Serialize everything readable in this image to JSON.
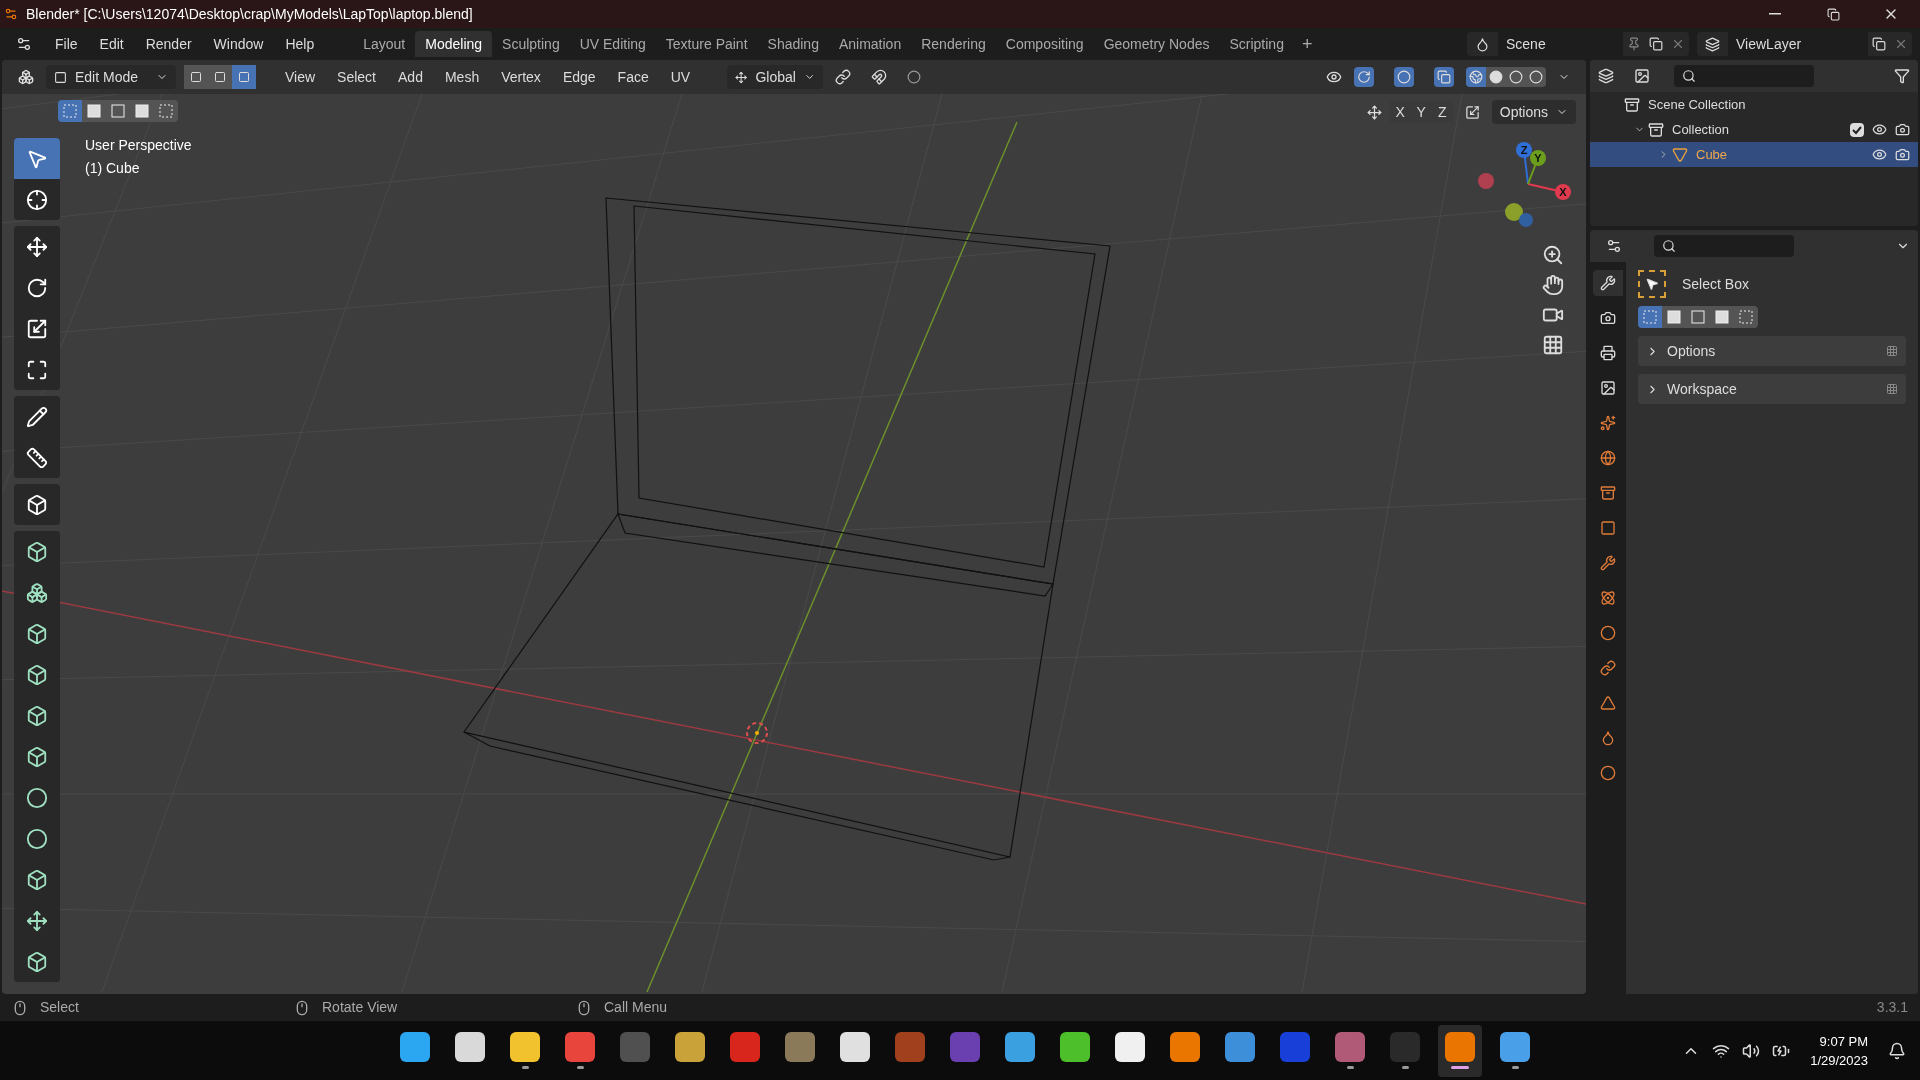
{
  "window": {
    "title": "Blender* [C:\\Users\\12074\\Desktop\\crap\\MyModels\\LapTop\\laptop.blend]"
  },
  "menus": [
    "File",
    "Edit",
    "Render",
    "Window",
    "Help"
  ],
  "workspaces": [
    {
      "label": "Layout",
      "selected": false
    },
    {
      "label": "Modeling",
      "selected": true
    },
    {
      "label": "Sculpting",
      "selected": false
    },
    {
      "label": "UV Editing",
      "selected": false
    },
    {
      "label": "Texture Paint",
      "selected": false
    },
    {
      "label": "Shading",
      "selected": false
    },
    {
      "label": "Animation",
      "selected": false
    },
    {
      "label": "Rendering",
      "selected": false
    },
    {
      "label": "Compositing",
      "selected": false
    },
    {
      "label": "Geometry Nodes",
      "selected": false
    },
    {
      "label": "Scripting",
      "selected": false
    }
  ],
  "add_workspace": "+",
  "scene": "Scene",
  "view_layer": "ViewLayer",
  "viewport_header": {
    "mode": "Edit Mode",
    "select_modes": [
      {
        "selected": false
      },
      {
        "selected": false
      },
      {
        "selected": true
      }
    ],
    "menus": [
      "View",
      "Select",
      "Add",
      "Mesh",
      "Vertex",
      "Edge",
      "Face",
      "UV"
    ],
    "orientation": "Global",
    "axes": [
      "X",
      "Y",
      "Z"
    ],
    "options": "Options",
    "box_modes": [
      {
        "selected": true
      },
      {
        "selected": false
      },
      {
        "selected": false
      },
      {
        "selected": false
      },
      {
        "selected": false
      }
    ]
  },
  "viewport": {
    "view_name": "User Perspective",
    "object_info": "(1) Cube",
    "gizmo": [
      {
        "label": "Z",
        "color": "#2f6fd6"
      },
      {
        "label": "Y",
        "color": "#6c9e1e"
      },
      {
        "label": "X",
        "color": "#e03a4e"
      }
    ]
  },
  "tool_groups": [
    [
      {
        "selected": true
      },
      {
        "selected": false
      }
    ],
    [
      {
        "selected": false
      },
      {
        "selected": false
      },
      {
        "selected": false
      },
      {
        "selected": false
      }
    ],
    [
      {
        "selected": false
      },
      {
        "selected": false
      }
    ],
    [
      {
        "selected": false
      }
    ],
    [
      {
        "selected": false
      },
      {
        "selected": false
      },
      {
        "selected": false
      },
      {
        "selected": false
      },
      {
        "selected": false
      },
      {
        "selected": false
      },
      {
        "selected": false
      },
      {
        "selected": false
      },
      {
        "selected": false
      },
      {
        "selected": false
      },
      {
        "selected": false
      }
    ]
  ],
  "outliner": [
    {
      "label": "Scene Collection",
      "children": [
        {
          "label": "Collection",
          "expanded": true,
          "checked": true,
          "children": [
            {
              "label": "Cube",
              "expanded": false,
              "selected": true
            }
          ]
        }
      ]
    }
  ],
  "properties": {
    "tabs": [
      {
        "selected": true
      },
      {
        "selected": false
      },
      {
        "selected": false
      },
      {
        "selected": false
      },
      {
        "selected": false
      },
      {
        "selected": false
      },
      {
        "selected": false
      },
      {
        "selected": false
      },
      {
        "selected": false
      },
      {
        "selected": false
      },
      {
        "selected": false
      },
      {
        "selected": false
      },
      {
        "selected": false
      },
      {
        "selected": false
      },
      {
        "selected": false
      }
    ],
    "tool": "Select Box",
    "box_modes": [
      {
        "selected": true
      },
      {
        "selected": false
      },
      {
        "selected": false
      },
      {
        "selected": false
      },
      {
        "selected": false
      }
    ],
    "panels": [
      {
        "label": "Options",
        "expanded": false
      },
      {
        "label": "Workspace",
        "expanded": false
      }
    ]
  },
  "status_bar": {
    "hints": [
      "Select",
      "Rotate View",
      "Call Menu"
    ],
    "version": "3.3.1"
  },
  "taskbar": {
    "apps": [
      {
        "color": "#2aa7f0",
        "running": false,
        "active": false
      },
      {
        "color": "#d9d9d9",
        "running": false,
        "active": false
      },
      {
        "color": "#f2c12e",
        "running": true,
        "active": false
      },
      {
        "color": "#e8453c",
        "running": true,
        "active": false
      },
      {
        "color": "#505050",
        "running": false,
        "active": false
      },
      {
        "color": "#c9a23a",
        "running": false,
        "active": false
      },
      {
        "color": "#d8261c",
        "running": false,
        "active": false
      },
      {
        "color": "#8a7a5a",
        "running": false,
        "active": false
      },
      {
        "color": "#e0e0e0",
        "running": false,
        "active": false
      },
      {
        "color": "#a0401c",
        "running": false,
        "active": false
      },
      {
        "color": "#6a3fb0",
        "running": false,
        "active": false
      },
      {
        "color": "#3aa0e0",
        "running": false,
        "active": false
      },
      {
        "color": "#4cbf2a",
        "running": false,
        "active": false
      },
      {
        "color": "#f0f0f0",
        "running": false,
        "active": false
      },
      {
        "color": "#ea7600",
        "running": false,
        "active": false
      },
      {
        "color": "#3c8fd8",
        "running": false,
        "active": false
      },
      {
        "color": "#1840d8",
        "running": false,
        "active": false
      },
      {
        "color": "#b05a78",
        "running": true,
        "active": false
      },
      {
        "color": "#2a2a2a",
        "running": true,
        "active": false
      },
      {
        "color": "#ea7601",
        "running": true,
        "active": true
      },
      {
        "color": "#4aa0e8",
        "running": true,
        "active": false
      }
    ],
    "time": "9:07 PM",
    "date": "1/29/2023"
  }
}
